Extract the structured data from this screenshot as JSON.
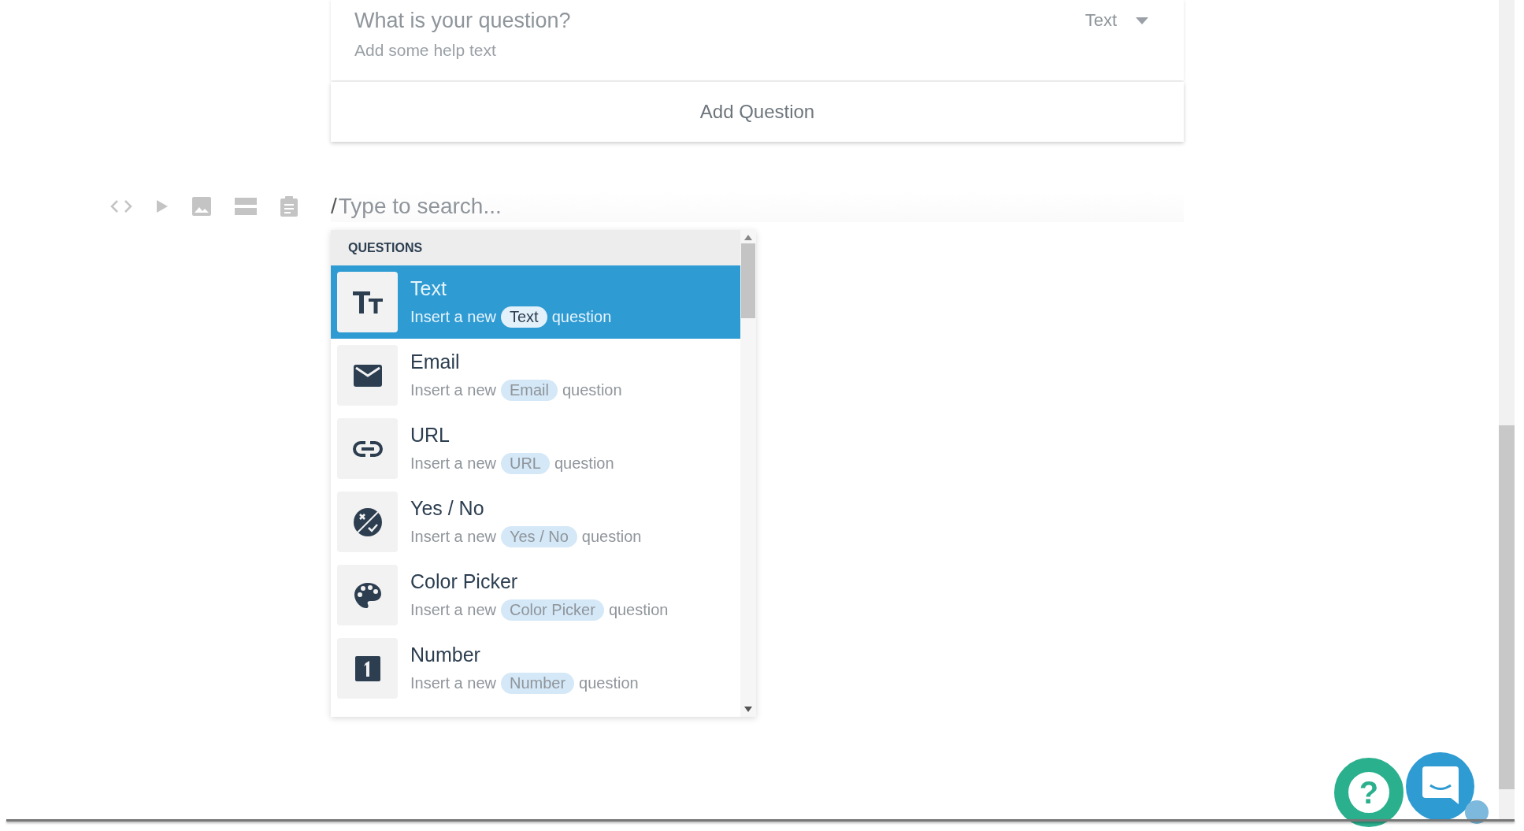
{
  "question_card": {
    "question_placeholder": "What is your question?",
    "type_select": "Text",
    "help_placeholder": "Add some help text"
  },
  "add_question_button": "Add Question",
  "search": {
    "prefix": "/",
    "placeholder": "Type to search..."
  },
  "dropdown": {
    "header": "QUESTIONS",
    "items": [
      {
        "kind": "text",
        "title": "Text",
        "prefix": "Insert a new",
        "tag": "Text",
        "suffix": "question",
        "selected": true
      },
      {
        "kind": "email",
        "title": "Email",
        "prefix": "Insert a new",
        "tag": "Email",
        "suffix": "question",
        "selected": false
      },
      {
        "kind": "url",
        "title": "URL",
        "prefix": "Insert a new",
        "tag": "URL",
        "suffix": "question",
        "selected": false
      },
      {
        "kind": "yesno",
        "title": "Yes / No",
        "prefix": "Insert a new",
        "tag": "Yes / No",
        "suffix": "question",
        "selected": false
      },
      {
        "kind": "color",
        "title": "Color Picker",
        "prefix": "Insert a new",
        "tag": "Color Picker",
        "suffix": "question",
        "selected": false
      },
      {
        "kind": "number",
        "title": "Number",
        "prefix": "Insert a new",
        "tag": "Number",
        "suffix": "question",
        "selected": false
      }
    ]
  },
  "help_button": {
    "label": "?"
  }
}
